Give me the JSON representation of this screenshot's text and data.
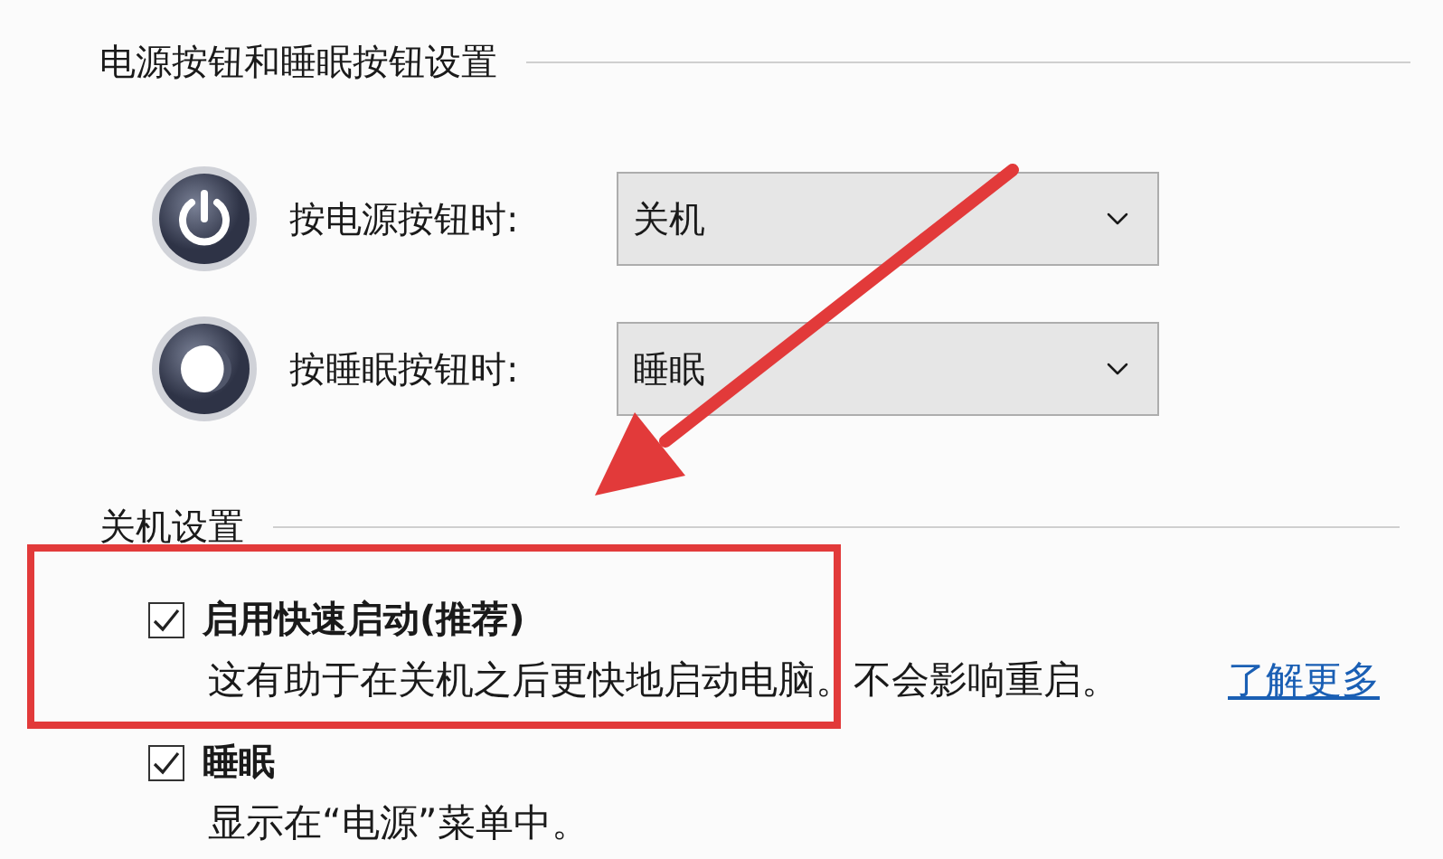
{
  "power_section": {
    "title": "电源按钮和睡眠按钮设置",
    "rows": [
      {
        "kind": "power",
        "label": "按电源按钮时:",
        "value": "关机"
      },
      {
        "kind": "sleep",
        "label": "按睡眠按钮时:",
        "value": "睡眠"
      }
    ]
  },
  "shutdown_section": {
    "title": "关机设置",
    "options": [
      {
        "label": "启用快速启动(推荐)",
        "checked": true,
        "description": "这有助于在关机之后更快地启动电脑。不会影响重启。",
        "link": "了解更多"
      },
      {
        "label": "睡眠",
        "checked": true,
        "description": "显示在“电源”菜单中。"
      }
    ]
  },
  "annotations": {
    "arrow": true,
    "highlight_box": true
  }
}
